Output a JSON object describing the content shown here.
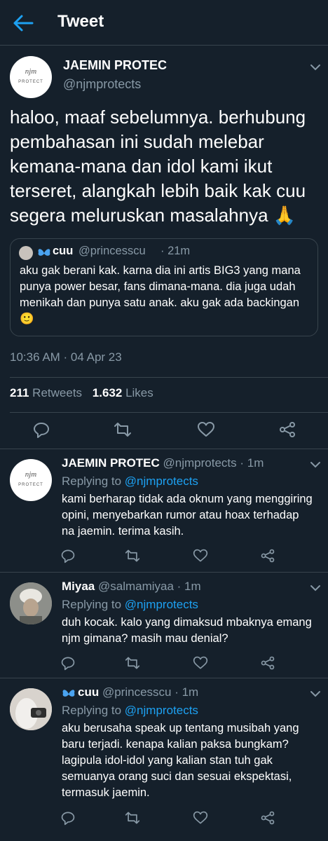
{
  "header": {
    "title": "Tweet"
  },
  "main_tweet": {
    "avatar_text_top": "njm",
    "avatar_text_bottom": "PROTECT",
    "name": "JAEMIN PROTEC",
    "handle": "@njmprotects",
    "text": "haloo, maaf sebelumnya. berhubung pembahasan ini sudah melebar kemana-mana dan idol kami ikut terseret, alangkah lebih baik kak cuu segera meluruskan masalahnya 🙏",
    "quote": {
      "name": "cuu",
      "handle": "@princesscu",
      "time": "· 21m",
      "text": "aku gak berani kak. karna dia ini artis BIG3 yang mana punya power besar, fans dimana-mana. dia juga udah menikah dan punya satu anak. aku gak ada backingan 🙂"
    },
    "timestamp": "10:36 AM · 04 Apr 23",
    "retweets_count": "211",
    "retweets_label": "Retweets",
    "likes_count": "1.632",
    "likes_label": "Likes"
  },
  "replies": [
    {
      "name": "JAEMIN PROTEC",
      "handle": "@njmprotects",
      "time": "· 1m",
      "replying_label": "Replying to",
      "replying_handle": "@njmprotects",
      "text": "kami berharap tidak ada oknum yang menggiring opini, menyebarkan rumor atau hoax terhadap na jaemin. terima kasih."
    },
    {
      "name": "Miyaa",
      "handle": "@salmamiyaa",
      "time": "· 1m",
      "replying_label": "Replying to",
      "replying_handle": "@njmprotects",
      "text": "duh kocak. kalo yang dimaksud mbaknya emang njm gimana? masih mau denial?"
    },
    {
      "name": "cuu",
      "handle": "@princesscu",
      "time": "· 1m",
      "replying_label": "Replying to",
      "replying_handle": "@njmprotects",
      "text": "aku berusaha speak up tentang musibah yang baru terjadi. kenapa kalian paksa bungkam? lagipula idol-idol yang kalian stan tuh gak semuanya orang suci dan sesuai ekspektasi, termasuk jaemin."
    }
  ],
  "colors": {
    "background": "#15202b",
    "accent": "#1da1f2",
    "muted": "#8899a6",
    "divider": "#38444d"
  }
}
